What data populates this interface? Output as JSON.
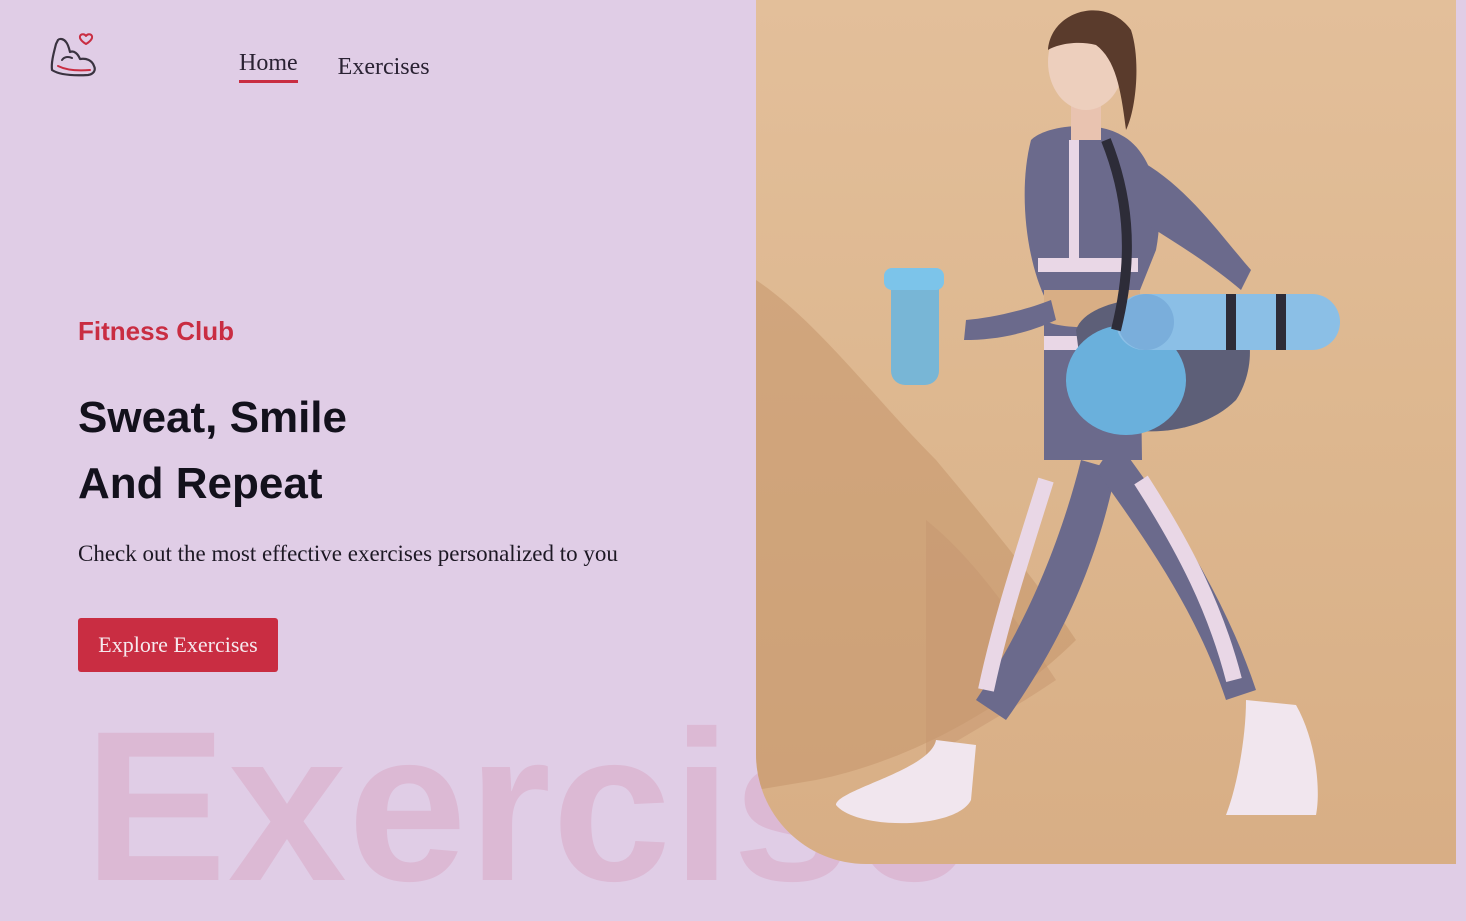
{
  "nav": {
    "links": [
      {
        "label": "Home",
        "active": true
      },
      {
        "label": "Exercises",
        "active": false
      }
    ]
  },
  "hero": {
    "tagline": "Fitness Club",
    "headline_line1": "Sweat, Smile",
    "headline_line2": "And Repeat",
    "subtitle": "Check out the most effective exercises personalized to you",
    "cta_label": "Explore Exercises",
    "background_word": "Exercise"
  },
  "colors": {
    "page_background": "#e0cde6",
    "accent": "#c92d42",
    "text_dark": "#13111c",
    "watermark": "#dcb9d4",
    "image_background": "#e3bf9a"
  },
  "icons": {
    "logo": "flexed-arm-heart-icon"
  }
}
